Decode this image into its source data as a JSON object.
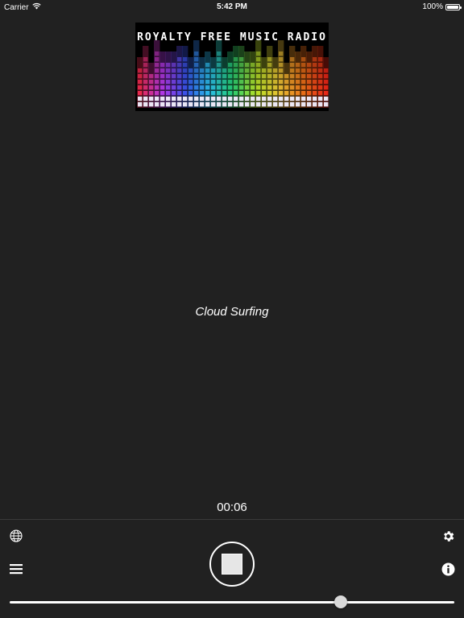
{
  "status_bar": {
    "carrier": "Carrier",
    "time": "5:42 PM",
    "battery": "100%",
    "icons": [
      "wifi-icon",
      "battery-icon"
    ]
  },
  "logo": {
    "text": "ROYALTY FREE MUSIC RADIO",
    "equalizer_colors": [
      "#ff2d55",
      "#c03cff",
      "#3a5bff",
      "#2fd0ff",
      "#29e07a",
      "#c6f52c",
      "#ffd23a",
      "#ff7a1a",
      "#ff2b1a"
    ]
  },
  "player": {
    "track_title": "Cloud Surfing",
    "elapsed_time": "00:06",
    "stop_button_icon": "stop-icon",
    "volume_level": 0.745
  },
  "controls": {
    "left_top_icon": "globe-icon",
    "left_bottom_icon": "menu-icon",
    "right_top_icon": "gear-icon",
    "right_bottom_icon": "info-icon"
  },
  "colors": {
    "background": "#212121",
    "foreground": "#ffffff",
    "divider": "#3a3a3a"
  }
}
